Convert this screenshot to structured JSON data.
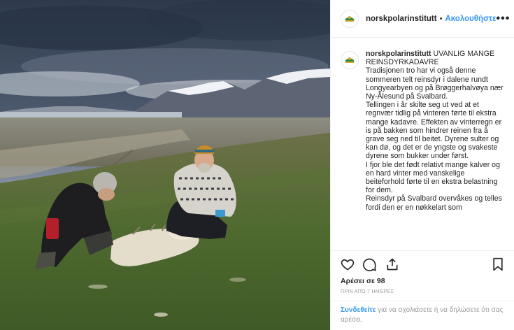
{
  "header": {
    "username": "norskpolarinstitutt",
    "separator": "•",
    "follow_label": "Ακολουθήστε",
    "more_label": "•••"
  },
  "caption": {
    "username": "norskpolarinstitutt",
    "title": "UVANLIG MANGE REINSDYRKADAVRE",
    "paragraphs": [
      "Tradisjonen tro har vi også denne sommeren telt reinsdyr i dalene rundt Longyearbyen og på Brøggerhalvøya nær Ny-Ålesund på Svalbard.",
      "Tellingen i år skilte seg ut ved at et regnvær tidlig på vinteren førte til ekstra mange kadavre. Effekten av vinterregn er is på bakken som hindrer reinen fra å grave seg ned til beitet. Dyrene sulter og kan dø, og det er de yngste og svakeste dyrene som bukker under først.",
      "I fjor ble det født relativt mange kalver og en hard vinter med vanskelige beiteforhold førte til en ekstra belastning for dem.",
      "Reinsdyr på Svalbard overvåkes og telles fordi den er en nøkkelart som"
    ]
  },
  "actions": {
    "likes": "Αρέσει σε 98",
    "timestamp": "ΠΡΙΝ ΑΠΌ 7 ΗΜΈΡΕΣ"
  },
  "login": {
    "link": "Συνδεθείτε",
    "text": " για να σχολιάσετε ή να δηλώσετε ότι σας αρέσει."
  },
  "colors": {
    "link": "#3897f0",
    "text": "#262626",
    "muted": "#999999"
  }
}
